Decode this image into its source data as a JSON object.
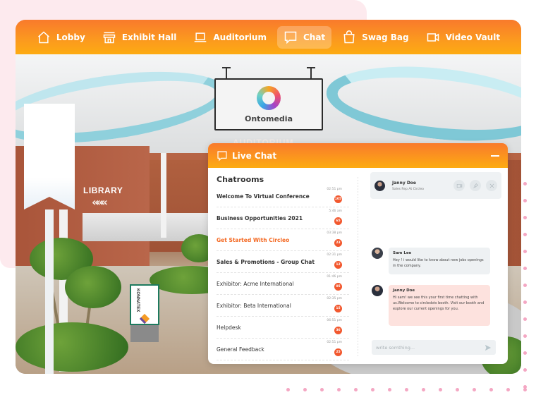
{
  "nav": {
    "items": [
      {
        "label": "Lobby",
        "icon": "home-icon"
      },
      {
        "label": "Exhibit Hall",
        "icon": "storefront-icon"
      },
      {
        "label": "Auditorium",
        "icon": "laptop-icon"
      },
      {
        "label": "Chat",
        "icon": "chat-bubble-icon",
        "active": true
      },
      {
        "label": "Swag Bag",
        "icon": "shopping-bag-icon"
      },
      {
        "label": "Video Vault",
        "icon": "video-camera-icon"
      }
    ]
  },
  "scene": {
    "sign_name": "Ontomedia",
    "auditorium_label": "AUDITORIUM",
    "library_label": "LIBRARY",
    "library_arrows": "«««",
    "kiosk_brand": "KONNATEX"
  },
  "chat": {
    "title": "Live Chat",
    "rooms_title": "Chatrooms",
    "rooms": [
      {
        "name": "Welcome To Virtual Conference",
        "time": "02:51 pm",
        "badge": "105",
        "style": "bold"
      },
      {
        "name": "Business Opportunities 2021",
        "time": "5:46 am",
        "badge": "65",
        "style": "bold"
      },
      {
        "name": "Get Started With Circleo",
        "time": "03:38 pm",
        "badge": "23",
        "style": "active"
      },
      {
        "name": "Sales & Promotions - Group Chat",
        "time": "02:31 pm",
        "badge": "12",
        "style": "bold"
      },
      {
        "name": "Exhibitor: Acme International",
        "time": "01:46 pm",
        "badge": "05",
        "style": "normal"
      },
      {
        "name": "Exhibitor: Beta International",
        "time": "02:35 pm",
        "badge": "15",
        "style": "normal"
      },
      {
        "name": "Helpdesk",
        "time": "06:51 pm",
        "badge": "36",
        "style": "normal"
      },
      {
        "name": "General Feedback",
        "time": "02:51 pm",
        "badge": "25",
        "style": "normal"
      }
    ],
    "contact": {
      "name": "Janny Doe",
      "role": "Sales Rep At Circleo"
    },
    "messages": [
      {
        "sender": "Sam Lee",
        "text": "Hey ! i would like to  know about new jobs openings in the company."
      },
      {
        "sender": "Janny Doe",
        "text": "Hi sam! we see this your first time chatting with us.Welcome to circledots booth. Visit our booth and explore our current openings for you."
      }
    ],
    "composer_placeholder": "write somthing..."
  },
  "colors": {
    "accent_orange": "#f97a2c",
    "accent_yellow": "#fdab12",
    "badge": "#f2582e",
    "active_room": "#f46a24",
    "outgoing_bubble": "#fde2de",
    "incoming_bubble": "#eef1f3",
    "pink_decor": "#fdeaee"
  }
}
